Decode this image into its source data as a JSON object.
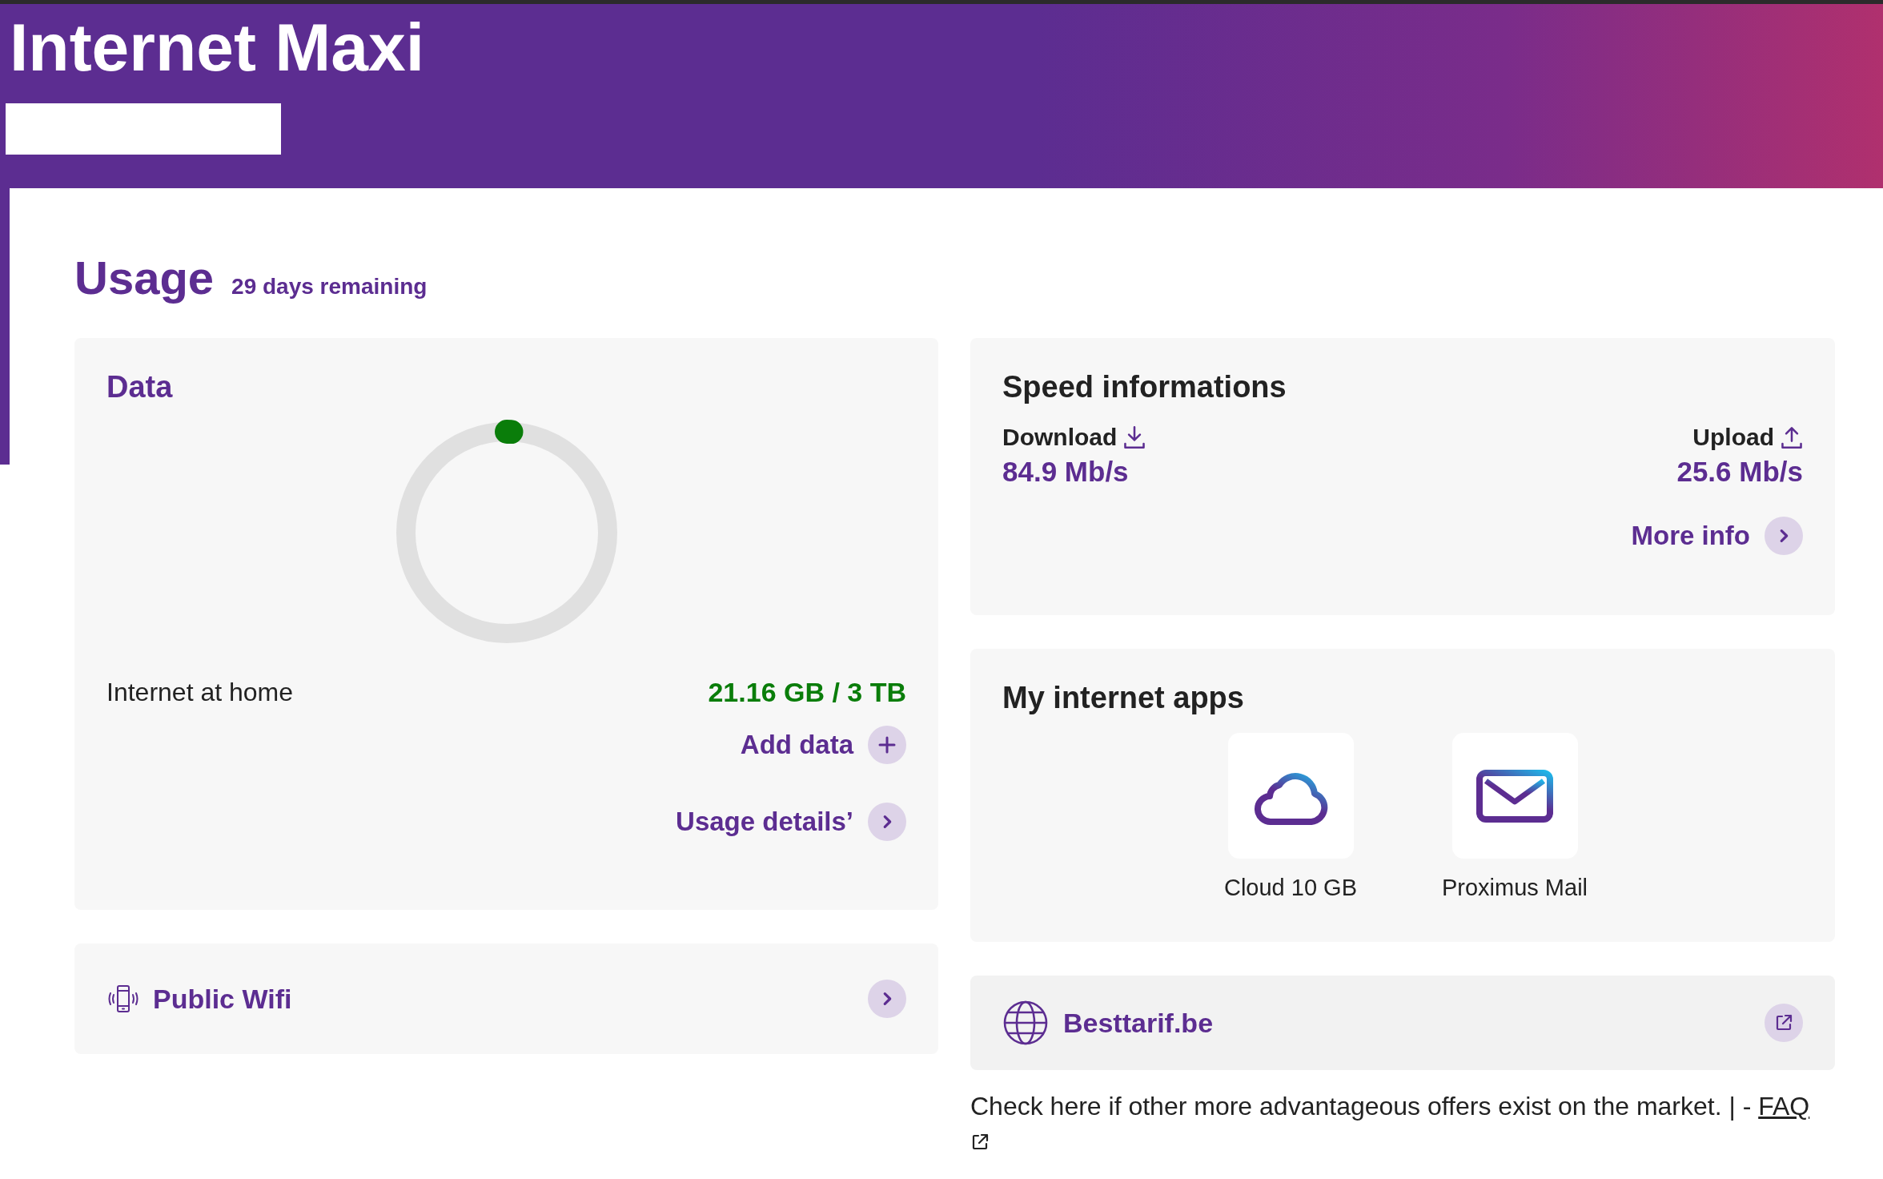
{
  "header": {
    "title": "Internet Maxi"
  },
  "usage": {
    "title": "Usage",
    "remaining": "29 days remaining"
  },
  "data_card": {
    "title": "Data",
    "meter": {
      "level": 0.007
    },
    "label": "Internet at home",
    "amount": "21.16 GB / 3 TB",
    "actions": [
      {
        "label": "Add data",
        "kind": "add"
      },
      {
        "label": "Usage details’",
        "kind": "arrow"
      }
    ]
  },
  "public_wifi": {
    "label": "Public Wifi"
  },
  "speed": {
    "title": "Speed informations",
    "items": [
      {
        "kind": "download",
        "label": "Download",
        "value": "84.9 Mb/s"
      },
      {
        "kind": "upload",
        "label": "Upload",
        "value": "25.6 Mb/s"
      }
    ],
    "more": "More info"
  },
  "apps": {
    "title": "My internet apps",
    "items": [
      {
        "kind": "cloud",
        "label": "Cloud 10 GB"
      },
      {
        "kind": "mail",
        "label": "Proximus Mail"
      }
    ]
  },
  "besttarif": {
    "label": "Besttarif.be",
    "note": "Check here if other more advantageous offers exist on the market. | -",
    "link": "FAQ"
  }
}
